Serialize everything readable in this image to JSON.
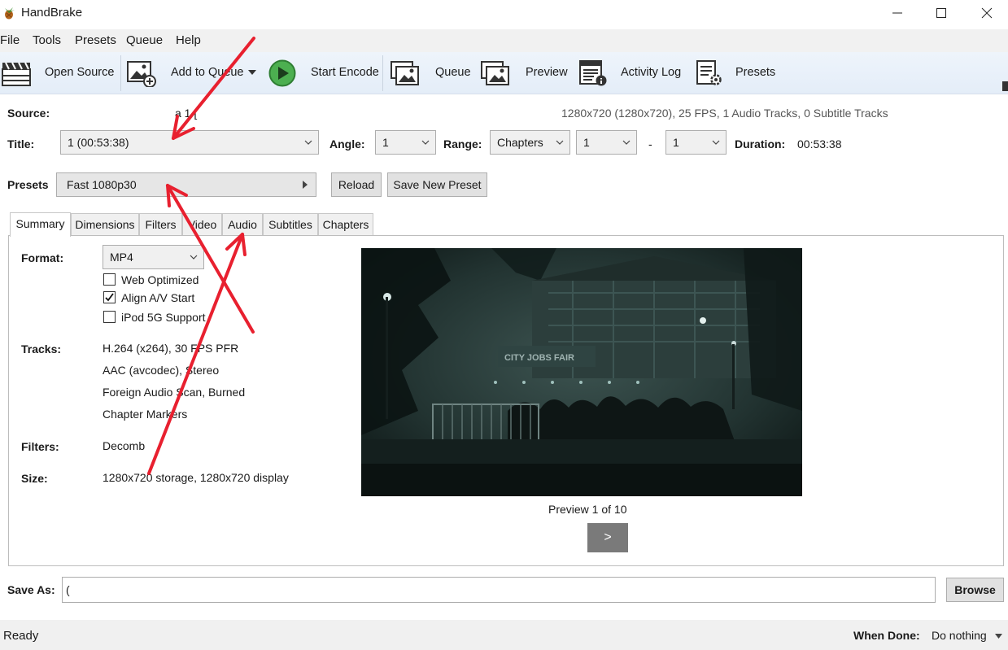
{
  "window": {
    "title": "HandBrake"
  },
  "menu": [
    "File",
    "Tools",
    "Presets",
    "Queue",
    "Help"
  ],
  "toolbar": {
    "open_source": "Open Source",
    "add_to_queue": "Add to Queue",
    "start_encode": "Start Encode",
    "queue": "Queue",
    "preview": "Preview",
    "activity_log": "Activity Log",
    "presets": "Presets"
  },
  "source": {
    "label": "Source:",
    "name": "a 1 [",
    "info": "1280x720 (1280x720), 25 FPS, 1 Audio Tracks, 0 Subtitle Tracks"
  },
  "title_row": {
    "title_label": "Title:",
    "title_value": "1 (00:53:38)",
    "angle_label": "Angle:",
    "angle_value": "1",
    "range_label": "Range:",
    "range_type": "Chapters",
    "range_start": "1",
    "range_sep": "-",
    "range_end": "1",
    "duration_label": "Duration:",
    "duration_value": "00:53:38"
  },
  "presets_row": {
    "label": "Presets",
    "value": "Fast 1080p30",
    "reload": "Reload",
    "save_new": "Save New Preset"
  },
  "tabs": [
    "Summary",
    "Dimensions",
    "Filters",
    "Video",
    "Audio",
    "Subtitles",
    "Chapters"
  ],
  "summary": {
    "format_label": "Format:",
    "format_value": "MP4",
    "options": [
      {
        "label": "Web Optimized",
        "checked": false
      },
      {
        "label": "Align A/V Start",
        "checked": true
      },
      {
        "label": "iPod 5G Support",
        "checked": false
      }
    ],
    "tracks_label": "Tracks:",
    "tracks": [
      "H.264 (x264), 30 FPS PFR",
      "AAC (avcodec), Stereo",
      "Foreign Audio Scan, Burned",
      "Chapter Markers"
    ],
    "filters_label": "Filters:",
    "filters_value": "Decomb",
    "size_label": "Size:",
    "size_value": "1280x720 storage, 1280x720 display",
    "preview_sign": "CITY JOBS FAIR",
    "preview_caption": "Preview 1 of 10",
    "next_label": ">"
  },
  "save_as": {
    "label": "Save As:",
    "value": "(",
    "browse": "Browse"
  },
  "status": {
    "text": "Ready",
    "when_done_label": "When Done:",
    "when_done_value": "Do nothing"
  },
  "colors": {
    "annotation_arrow": "#e8202f",
    "toolbar_bg": "#e8f0fa",
    "play_green": "#4caf50"
  }
}
